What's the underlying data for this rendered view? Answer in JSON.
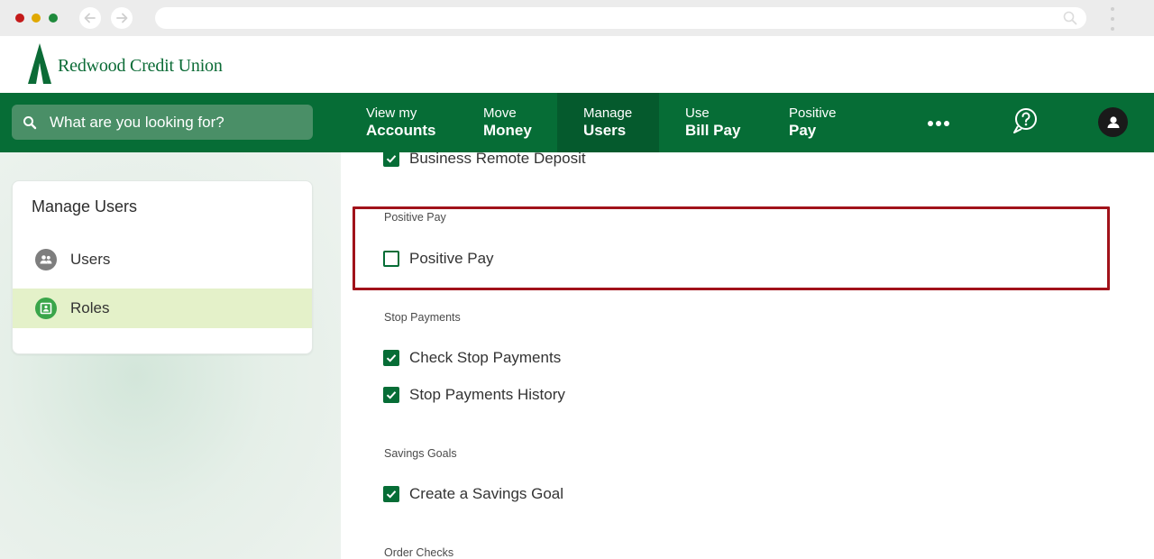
{
  "brand": {
    "name": "Redwood Credit Union"
  },
  "search": {
    "placeholder": "What are you looking for?"
  },
  "nav": {
    "items": [
      {
        "line1": "View my",
        "line2": "Accounts"
      },
      {
        "line1": "Move",
        "line2": "Money"
      },
      {
        "line1": "Manage",
        "line2": "Users"
      },
      {
        "line1": "Use",
        "line2": "Bill Pay"
      },
      {
        "line1": "Positive",
        "line2": "Pay"
      }
    ],
    "active": "Manage Users"
  },
  "sidebar": {
    "title": "Manage Users",
    "items": [
      {
        "label": "Users",
        "icon": "users-icon"
      },
      {
        "label": "Roles",
        "icon": "roles-icon",
        "selected": true
      }
    ]
  },
  "content": {
    "top_item": {
      "label": "Business Remote Deposit",
      "checked": true
    },
    "sections": [
      {
        "heading": "Positive Pay",
        "items": [
          {
            "label": "Positive Pay",
            "checked": false
          }
        ]
      },
      {
        "heading": "Stop Payments",
        "items": [
          {
            "label": "Check Stop Payments",
            "checked": true
          },
          {
            "label": "Stop Payments History",
            "checked": true
          }
        ]
      },
      {
        "heading": "Savings Goals",
        "items": [
          {
            "label": "Create a Savings Goal",
            "checked": true
          }
        ]
      },
      {
        "heading": "Order Checks",
        "items": []
      }
    ]
  },
  "colors": {
    "brand_green": "#066d36",
    "highlight_red": "#a1121a",
    "selected_bg": "#e4f1c9"
  }
}
